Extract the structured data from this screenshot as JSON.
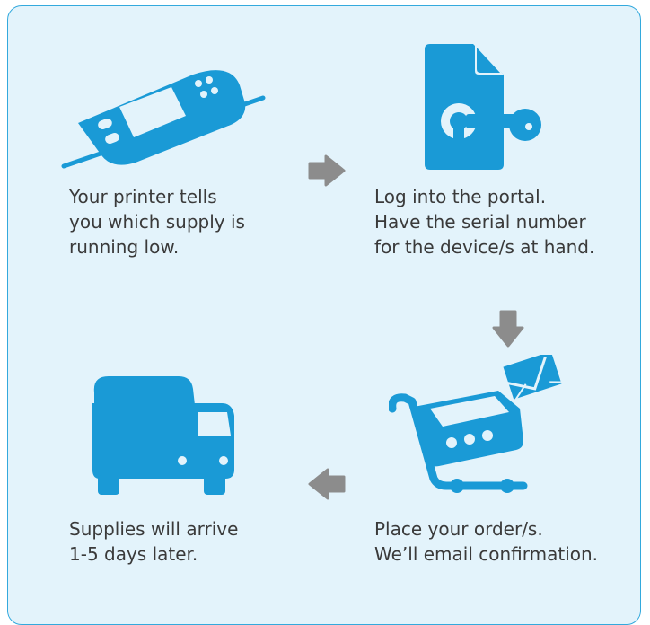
{
  "colors": {
    "accent": "#1a9ad6",
    "panel": "#e3f3fb",
    "border": "#33a9dd",
    "arrow": "#8c8c8c",
    "text": "#3a3a3a"
  },
  "steps": [
    {
      "icon": "printer-panel-icon",
      "lines": [
        "Your printer tells",
        "you which supply is",
        "running low."
      ]
    },
    {
      "icon": "document-key-icon",
      "lines": [
        "Log into the portal.",
        "Have the serial number",
        "for the device/s at hand."
      ]
    },
    {
      "icon": "shopping-cart-envelope-icon",
      "lines": [
        "Place your order/s.",
        "We’ll email confirmation."
      ]
    },
    {
      "icon": "delivery-truck-icon",
      "lines": [
        "Supplies will arrive",
        "1-5 days later."
      ]
    }
  ],
  "arrows": [
    "arrow-right-icon",
    "arrow-down-icon",
    "arrow-left-icon"
  ]
}
